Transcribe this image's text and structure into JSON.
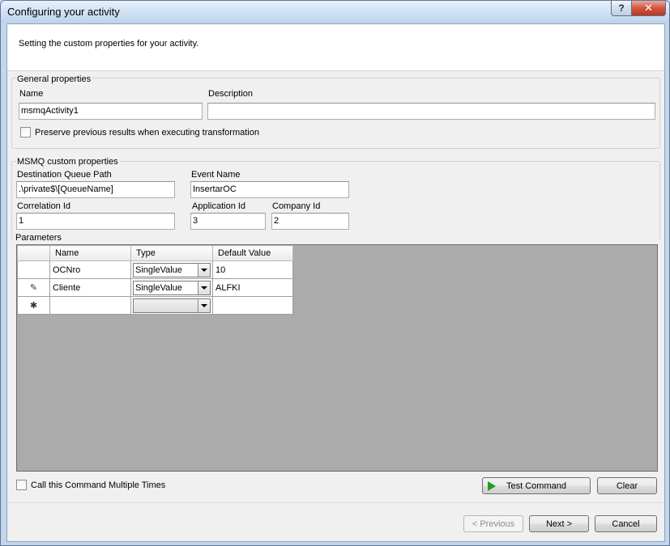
{
  "window": {
    "title": "Configuring your activity",
    "help_label": "?",
    "close_label": "✕"
  },
  "header": {
    "text": "Setting the custom properties for your activity."
  },
  "general": {
    "title": "General properties",
    "name_label": "Name",
    "name_value": "msmqActivity1",
    "description_label": "Description",
    "description_value": "",
    "preserve_label": "Preserve previous results when executing transformation",
    "preserve_checked": false
  },
  "msmq": {
    "title": "MSMQ custom properties",
    "dest_label": "Destination Queue Path",
    "dest_value": ".\\private$\\[QueueName]",
    "event_label": "Event Name",
    "event_value": "InsertarOC",
    "correlation_label": "Correlation Id",
    "correlation_value": "1",
    "application_label": "Application Id",
    "application_value": "3",
    "company_label": "Company Id",
    "company_value": "2"
  },
  "parameters": {
    "label": "Parameters",
    "columns": [
      "Name",
      "Type",
      "Default Value"
    ],
    "rows": [
      {
        "indicator": "",
        "name": "OCNro",
        "type": "SingleValue",
        "default": "10"
      },
      {
        "indicator": "✎",
        "name": "Cliente",
        "type": "SingleValue",
        "default": "ALFKI"
      },
      {
        "indicator": "✱",
        "name": "",
        "type": "",
        "default": ""
      }
    ]
  },
  "options": {
    "multiple_label": "Call this Command Multiple Times",
    "multiple_checked": false
  },
  "buttons": {
    "test": "Test Command",
    "clear": "Clear",
    "previous": "< Previous",
    "next": "Next >",
    "cancel": "Cancel"
  }
}
